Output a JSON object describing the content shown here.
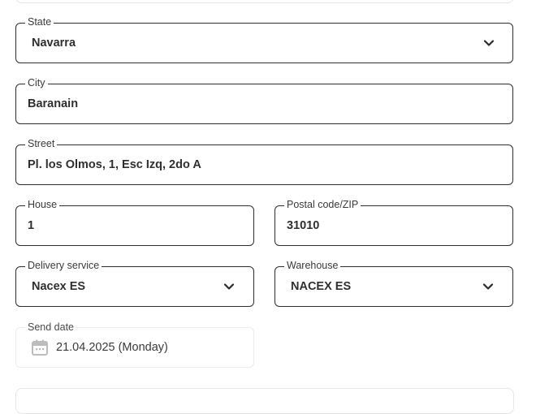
{
  "form": {
    "state": {
      "label": "State",
      "value": "Navarra"
    },
    "city": {
      "label": "City",
      "value": "Baranain"
    },
    "street": {
      "label": "Street",
      "value": "Pl. los Olmos, 1, Esc Izq, 2do A"
    },
    "house": {
      "label": "House",
      "value": "1"
    },
    "postal": {
      "label": "Postal code/ZIP",
      "value": "31010"
    },
    "delivery": {
      "label": "Delivery service",
      "value": "Nacex ES"
    },
    "warehouse": {
      "label": "Warehouse",
      "value": "NACEX ES"
    },
    "send_date": {
      "label": "Send date",
      "value": "21.04.2025 (Monday)"
    }
  },
  "icons": {
    "dropdown": "chevron-down-icon",
    "calendar": "calendar-icon"
  },
  "colors": {
    "border": "#2e2e2e",
    "text": "#2f2f2f",
    "soft_border": "#ececec",
    "icon_gray": "#bdbdbd"
  }
}
